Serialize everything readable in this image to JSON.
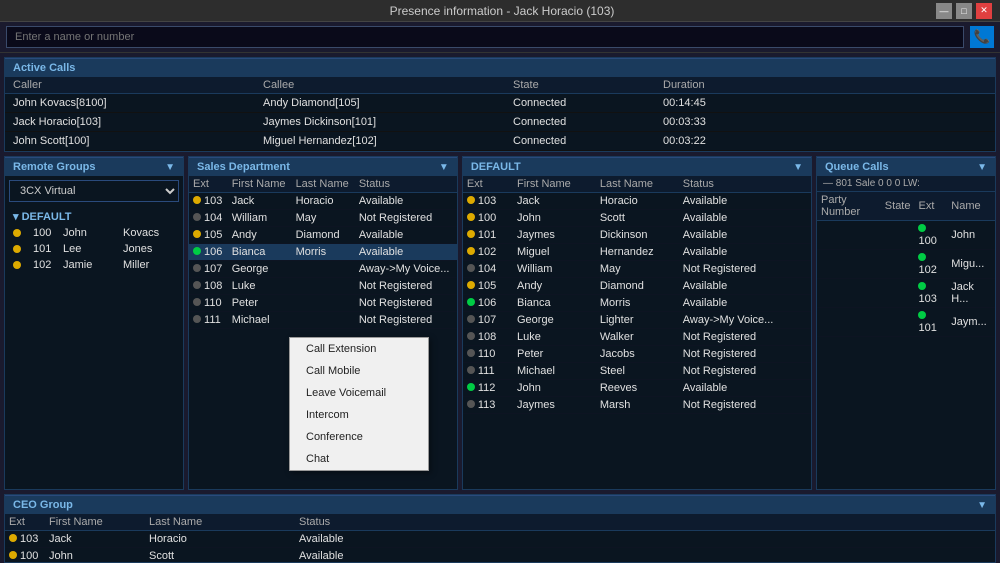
{
  "titlebar": {
    "title": "Presence information - Jack Horacio (103)",
    "minimize": "—",
    "maximize": "□",
    "close": "✕"
  },
  "searchbar": {
    "placeholder": "Enter a name or number"
  },
  "activeCalls": {
    "sectionTitle": "Active Calls",
    "headers": [
      "Caller",
      "Callee",
      "State",
      "Duration"
    ],
    "rows": [
      {
        "caller": "John Kovacs[8100]",
        "callee": "Andy Diamond[105]",
        "state": "Connected",
        "duration": "00:14:45"
      },
      {
        "caller": "Jack Horacio[103]",
        "callee": "Jaymes Dickinson[101]",
        "state": "Connected",
        "duration": "00:03:33"
      },
      {
        "caller": "John Scott[100]",
        "callee": "Miguel Hernandez[102]",
        "state": "Connected",
        "duration": "00:03:22"
      }
    ]
  },
  "remoteGroups": {
    "sectionTitle": "Remote Groups",
    "selectedGroup": "3CX Virtual",
    "groupName": "DEFAULT",
    "items": [
      {
        "ext": "100",
        "first": "John",
        "last": "Kovacs",
        "status": "yellow"
      },
      {
        "ext": "101",
        "first": "Lee",
        "last": "Jones",
        "status": "yellow"
      },
      {
        "ext": "102",
        "first": "Jamie",
        "last": "Miller",
        "status": "yellow"
      }
    ]
  },
  "salesDept": {
    "sectionTitle": "Sales Department",
    "headers": [
      "Ext",
      "First Name",
      "Last Name",
      "Status"
    ],
    "rows": [
      {
        "ext": "103",
        "first": "Jack",
        "last": "Horacio",
        "status": "Available",
        "dot": "yellow"
      },
      {
        "ext": "104",
        "first": "William",
        "last": "May",
        "status": "Not Registered",
        "dot": "gray"
      },
      {
        "ext": "105",
        "first": "Andy",
        "last": "Diamond",
        "status": "Available",
        "dot": "yellow"
      },
      {
        "ext": "106",
        "first": "Bianca",
        "last": "Morris",
        "status": "Available",
        "dot": "green",
        "selected": true
      },
      {
        "ext": "107",
        "first": "George",
        "last": "",
        "status": "Away->My Voice...",
        "dot": "gray"
      },
      {
        "ext": "108",
        "first": "Luke",
        "last": "",
        "status": "Not Registered",
        "dot": "gray"
      },
      {
        "ext": "110",
        "first": "Peter",
        "last": "",
        "status": "Not Registered",
        "dot": "gray"
      },
      {
        "ext": "111",
        "first": "Michael",
        "last": "",
        "status": "Not Registered",
        "dot": "gray"
      }
    ]
  },
  "contextMenu": {
    "items": [
      "Call Extension",
      "Call Mobile",
      "Leave Voicemail",
      "Intercom",
      "Conference",
      "Chat"
    ]
  },
  "defaultPanel": {
    "sectionTitle": "DEFAULT",
    "headers": [
      "Ext",
      "First Name",
      "Last Name",
      "Status"
    ],
    "rows": [
      {
        "ext": "103",
        "first": "Jack",
        "last": "Horacio",
        "status": "Available",
        "dot": "yellow"
      },
      {
        "ext": "100",
        "first": "John",
        "last": "Scott",
        "status": "Available",
        "dot": "yellow"
      },
      {
        "ext": "101",
        "first": "Jaymes",
        "last": "Dickinson",
        "status": "Available",
        "dot": "yellow"
      },
      {
        "ext": "102",
        "first": "Miguel",
        "last": "Hernandez",
        "status": "Available",
        "dot": "yellow"
      },
      {
        "ext": "104",
        "first": "William",
        "last": "May",
        "status": "Not Registered",
        "dot": "gray"
      },
      {
        "ext": "105",
        "first": "Andy",
        "last": "Diamond",
        "status": "Available",
        "dot": "yellow"
      },
      {
        "ext": "106",
        "first": "Bianca",
        "last": "Morris",
        "status": "Available",
        "dot": "green"
      },
      {
        "ext": "107",
        "first": "George",
        "last": "Lighter",
        "status": "Away->My Voice...",
        "dot": "gray"
      },
      {
        "ext": "108",
        "first": "Luke",
        "last": "Walker",
        "status": "Not Registered",
        "dot": "gray"
      },
      {
        "ext": "110",
        "first": "Peter",
        "last": "Jacobs",
        "status": "Not Registered",
        "dot": "gray"
      },
      {
        "ext": "111",
        "first": "Michael",
        "last": "Steel",
        "status": "Not Registered",
        "dot": "gray"
      },
      {
        "ext": "112",
        "first": "John",
        "last": "Reeves",
        "status": "Available",
        "dot": "green"
      },
      {
        "ext": "113",
        "first": "Jaymes",
        "last": "Marsh",
        "status": "Not Registered",
        "dot": "gray"
      }
    ]
  },
  "queueCalls": {
    "sectionTitle": "Queue Calls",
    "queueInfo": "— 801 Sale 0  0  0  LW:",
    "headers": [
      "Party Number",
      "State",
      "Ext",
      "Name"
    ],
    "rows": [
      {
        "party": "",
        "state": "",
        "ext": "100",
        "name": "John",
        "dot": "green"
      },
      {
        "party": "",
        "state": "",
        "ext": "102",
        "name": "Migu...",
        "dot": "green"
      },
      {
        "party": "",
        "state": "",
        "ext": "103",
        "name": "Jack H...",
        "dot": "green"
      },
      {
        "party": "",
        "state": "",
        "ext": "101",
        "name": "Jaym...",
        "dot": "green"
      }
    ]
  },
  "ceoGroup": {
    "sectionTitle": "CEO Group",
    "headers": [
      "Ext",
      "First Name",
      "Last Name",
      "Status"
    ],
    "rows": [
      {
        "ext": "103",
        "first": "Jack",
        "last": "Horacio",
        "status": "Available",
        "dot": "yellow"
      },
      {
        "ext": "100",
        "first": "John",
        "last": "Scott",
        "status": "Available",
        "dot": "yellow"
      }
    ]
  }
}
